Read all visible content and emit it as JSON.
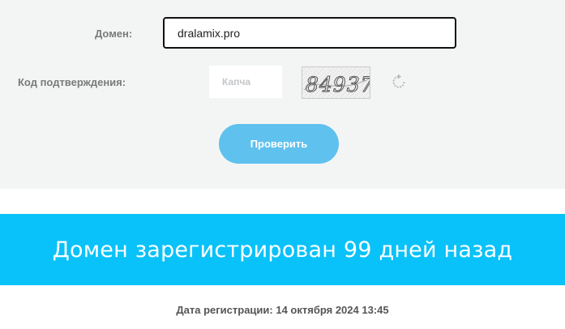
{
  "form": {
    "domain_label": "Домен:",
    "domain_value": "dralamix.pro",
    "captcha_label": "Код подтверждения:",
    "captcha_placeholder": "Капча",
    "captcha_image_text": "84937",
    "refresh_icon": "refresh-icon",
    "check_button_label": "Проверить",
    "button_color": "#5fc1ee"
  },
  "result": {
    "title": "Домен зарегистрирован 99 дней назад",
    "banner_color": "#09c2f9",
    "registration_date": "Дата регистрации: 14 октября 2024 13:45"
  }
}
